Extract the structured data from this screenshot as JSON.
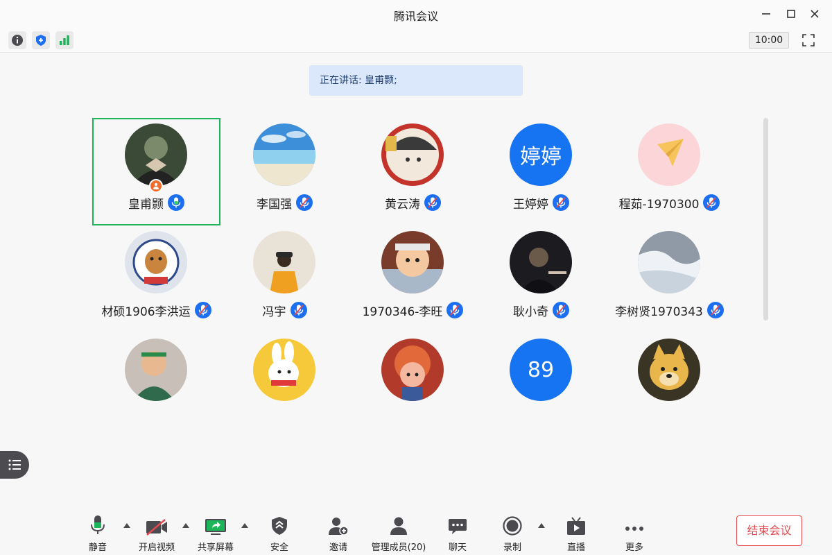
{
  "window": {
    "title": "腾讯会议"
  },
  "infobar": {
    "timer": "10:00"
  },
  "speaking": {
    "text": "正在讲话: 皇甫颢;"
  },
  "participants": [
    {
      "name": "皇甫颢",
      "avatar": "photo",
      "palette": [
        "#3a4a36",
        "#7a8a6a",
        "#d6c8b0"
      ],
      "host": true,
      "mic": "on",
      "active": true
    },
    {
      "name": "李国强",
      "avatar": "beach",
      "palette": [
        "#3e8fd9",
        "#8fd0ee",
        "#efe6d0"
      ],
      "mic": "muted"
    },
    {
      "name": "黄云涛",
      "avatar": "cartoon",
      "palette": [
        "#c4332a",
        "#f2e8dc",
        "#3a3a3a"
      ],
      "mic": "muted"
    },
    {
      "name": "王婷婷",
      "avatar": "text",
      "avatar_text": "婷婷",
      "mic": "muted"
    },
    {
      "name": "程茹-1970300",
      "avatar": "plane",
      "palette": [
        "#fbd5d8",
        "#f6c45a",
        "#fbe6e8"
      ],
      "mic": "muted"
    },
    {
      "name": "材硕1906李洪运",
      "avatar": "badge",
      "palette": [
        "#dfe3ec",
        "#c9843e",
        "#2d4a8a"
      ],
      "mic": "muted"
    },
    {
      "name": "冯宇",
      "avatar": "kid",
      "palette": [
        "#e9e2d6",
        "#f0a020",
        "#2a2a2a"
      ],
      "mic": "muted"
    },
    {
      "name": "1970346-李旺",
      "avatar": "anime",
      "palette": [
        "#7a3c2a",
        "#f4c8a0",
        "#e8e8e8"
      ],
      "mic": "muted"
    },
    {
      "name": "耿小奇",
      "avatar": "dark",
      "palette": [
        "#1c1c20",
        "#6a5a4a",
        "#d0c0b0"
      ],
      "mic": "muted"
    },
    {
      "name": "李树贤1970343",
      "avatar": "snow",
      "palette": [
        "#8f9aa6",
        "#eef2f6",
        "#5a5f66"
      ],
      "mic": "muted"
    },
    {
      "name": "",
      "avatar": "boy",
      "palette": [
        "#c8c0b8",
        "#2f6a4c",
        "#e8b890"
      ]
    },
    {
      "name": "",
      "avatar": "bunny",
      "palette": [
        "#f6c93a",
        "#ffffff",
        "#e03a3a"
      ]
    },
    {
      "name": "",
      "avatar": "curly",
      "palette": [
        "#b23a2a",
        "#f4b8a0",
        "#e26a3a"
      ]
    },
    {
      "name": "",
      "avatar": "text",
      "avatar_text": "89"
    },
    {
      "name": "",
      "avatar": "dog",
      "palette": [
        "#3a3424",
        "#e8b64a",
        "#f4e0b0"
      ]
    }
  ],
  "toolbar": {
    "mute": "静音",
    "video": "开启视频",
    "share": "共享屏幕",
    "security": "安全",
    "invite": "邀请",
    "members": "管理成员(20)",
    "chat": "聊天",
    "record": "录制",
    "live": "直播",
    "more": "更多",
    "end": "结束会议"
  },
  "colors": {
    "accent": "#1d6ff2",
    "active_border": "#1eb55a",
    "end": "#e5484d",
    "host": "#f26b2a"
  }
}
